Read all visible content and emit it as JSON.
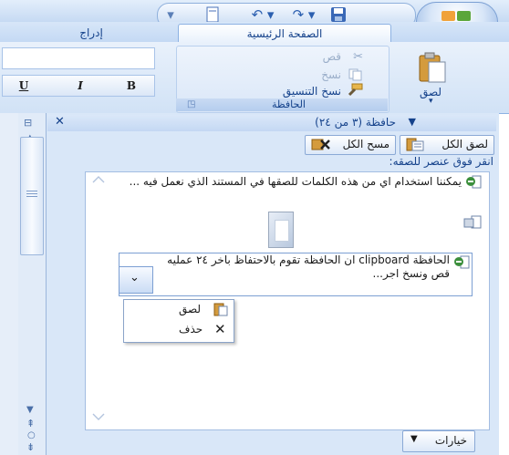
{
  "quick_access": {
    "save_icon": "save-icon",
    "redo_icon": "redo-icon",
    "undo_icon": "undo-icon",
    "new_icon": "new-doc-icon"
  },
  "tabs": {
    "home": "الصفحة الرئيسية",
    "insert": "إدراج"
  },
  "ribbon": {
    "paste_label": "لصق",
    "cut_label": "قص",
    "copy_label": "نسخ",
    "format_painter_label": "نسخ التنسيق",
    "group_title": "الحافظة",
    "bold": "B",
    "italic": "I",
    "underline": "U"
  },
  "pane": {
    "title": "حافظة (٣ من ٢٤)",
    "paste_all": "لصق الكل",
    "clear_all": "مسح الكل",
    "hint": "انقر فوق عنصر للصقه:",
    "items": [
      {
        "text": "يمكننا استخدام اي من هذه الكلمات للصقها في المستند الذي نعمل فيه ..."
      },
      {
        "text": ""
      },
      {
        "text": "الحافظة clipboard ان الحافظة تقوم بالاحتفاظ باخر ٢٤ عمليه قص ونسخ اجر..."
      }
    ],
    "context_menu": {
      "paste": "لصق",
      "delete": "حذف"
    },
    "options": "خيارات"
  },
  "colors": {
    "ribbon_blue": "#c4d9f4",
    "text_blue": "#15428b",
    "office_orange": "#f08a1c"
  }
}
